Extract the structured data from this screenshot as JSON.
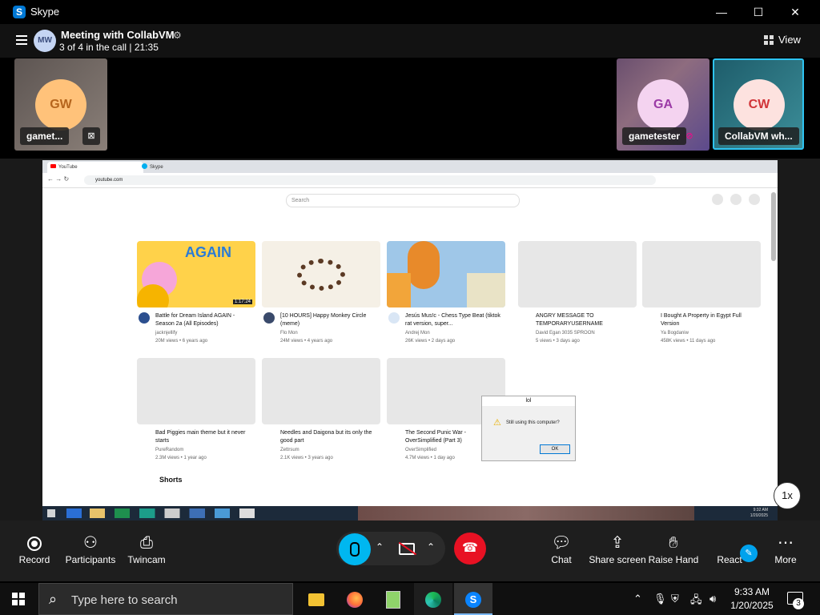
{
  "window": {
    "app_title": "Skype",
    "logo": "S",
    "minimize": "—",
    "maximize": "☐",
    "close": "✕"
  },
  "meeting": {
    "avatar_initials": "MW",
    "title": "Meeting with CollabVM",
    "subtitle": "3 of 4 in the call | 21:35",
    "view_label": "View"
  },
  "participants": [
    {
      "initials": "GW",
      "name": "gamet...",
      "avatar_bg": "#ffc27a",
      "avatar_fg": "#b5651d"
    },
    {
      "initials": "GA",
      "name": "gametester",
      "avatar_bg": "#f4d3f0",
      "avatar_fg": "#9b3aa6"
    },
    {
      "initials": "CW",
      "name": "CollabVM wh...",
      "avatar_bg": "#fde2df",
      "avatar_fg": "#d13438",
      "active": true
    }
  ],
  "shared_screen": {
    "tabs": [
      "YouTube",
      "Skype"
    ],
    "url": "youtube.com",
    "search_placeholder": "Search",
    "videos": [
      {
        "title": "Battle for Dream Island AGAIN - Season 2a (All Episodes)",
        "channel": "jacknjellify",
        "meta": "20M views • 6 years ago",
        "thumb": "#ffd24a",
        "duration": "1:17:24"
      },
      {
        "title": "[10 HOURS] Happy Monkey Circle (meme)",
        "channel": "Flo Mon",
        "meta": "24M views • 4 years ago",
        "thumb": "#f5f0e6"
      },
      {
        "title": "Jesús Mus!c - Chess Type Beat (tiktok rat version, super...",
        "channel": "Andrej Mon",
        "meta": "26K views • 2 days ago",
        "thumb": "#9fc7e8"
      },
      {
        "title": "ANGRY MESSAGE TO TEMPORARYUSERNAME",
        "channel": "David Egan 3035 SPROON",
        "meta": "5 views • 3 days ago",
        "thumb": "#e7e7e7"
      },
      {
        "title": "I Bought A Property in Egypt Full Version",
        "channel": "Ya Bogdaniw",
        "meta": "458K views • 11 days ago",
        "thumb": "#e7e7e7"
      },
      {
        "title": "Bad Piggies main theme but it never starts",
        "channel": "PureRandom",
        "meta": "2.3M views • 1 year ago",
        "thumb": "#e7e7e7"
      },
      {
        "title": "Needles and Daigona but its only the good part",
        "channel": "Zettrsum",
        "meta": "2.1K views • 3 years ago",
        "thumb": "#e7e7e7"
      },
      {
        "title": "The Second Punic War - OverSimplified (Part 3)",
        "channel": "OverSimplified",
        "meta": "4.7M views • 1 day ago",
        "thumb": "#e7e7e7"
      }
    ],
    "shorts_label": "Shorts",
    "dialog": {
      "title": "lol",
      "message": "Still using this computer?",
      "ok": "OK"
    },
    "inner_clock": {
      "time": "9:32 AM",
      "date": "1/20/2025"
    },
    "playback_speed": "1x"
  },
  "controls": {
    "record": "Record",
    "participants": "Participants",
    "twincam": "Twincam",
    "chat": "Chat",
    "share_screen": "Share screen",
    "raise_hand": "Raise Hand",
    "react": "React",
    "more": "More"
  },
  "taskbar": {
    "search_placeholder": "Type here to search",
    "time": "9:33 AM",
    "date": "1/20/2025",
    "notification_count": "3"
  }
}
